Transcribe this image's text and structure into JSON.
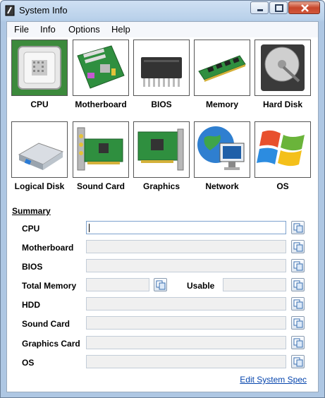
{
  "window": {
    "title": "System Info"
  },
  "menu": [
    "File",
    "Info",
    "Options",
    "Help"
  ],
  "tiles_row1": [
    {
      "label": "CPU",
      "icon": "cpu-icon"
    },
    {
      "label": "Motherboard",
      "icon": "motherboard-icon"
    },
    {
      "label": "BIOS",
      "icon": "bios-chip-icon"
    },
    {
      "label": "Memory",
      "icon": "memory-icon"
    },
    {
      "label": "Hard Disk",
      "icon": "hard-disk-icon"
    }
  ],
  "tiles_row2": [
    {
      "label": "Logical Disk",
      "icon": "logical-disk-icon"
    },
    {
      "label": "Sound Card",
      "icon": "sound-card-icon"
    },
    {
      "label": "Graphics",
      "icon": "graphics-card-icon"
    },
    {
      "label": "Network",
      "icon": "network-icon"
    },
    {
      "label": "OS",
      "icon": "windows-logo-icon"
    }
  ],
  "summary": {
    "title": "Summary",
    "rows": [
      "CPU",
      "Motherboard",
      "BIOS",
      "Total Memory",
      "HDD",
      "Sound Card",
      "Graphics Card",
      "OS"
    ],
    "usable_label": "Usable"
  },
  "footer": {
    "link": "Edit System Spec"
  },
  "colors": {
    "selected_tile": "#3c8a3c",
    "link": "#0645ad"
  }
}
